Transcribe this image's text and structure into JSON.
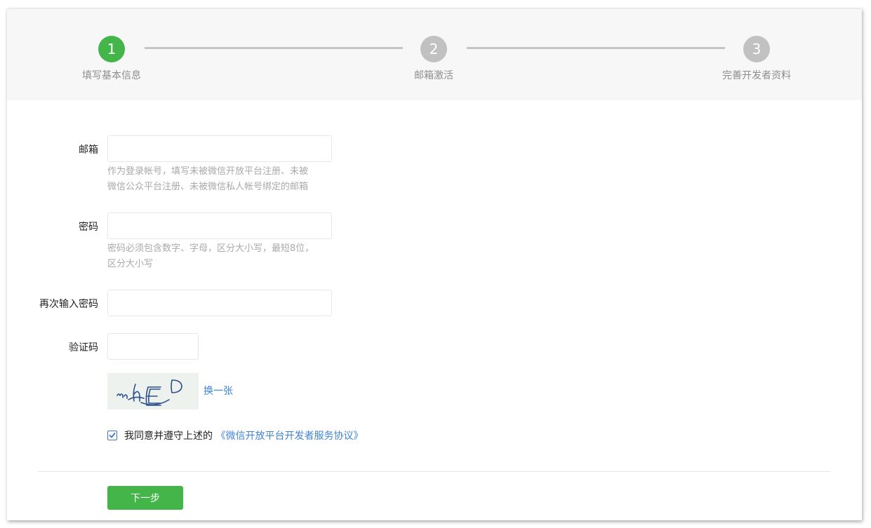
{
  "steps": [
    {
      "number": "1",
      "label": "填写基本信息"
    },
    {
      "number": "2",
      "label": "邮箱激活"
    },
    {
      "number": "3",
      "label": "完善开发者资料"
    }
  ],
  "form": {
    "email": {
      "label": "邮箱",
      "value": "",
      "hint_line1": "作为登录帐号，填写未被微信开放平台注册、未被",
      "hint_line2": "微信公众平台注册、未被微信私人帐号绑定的邮箱"
    },
    "password": {
      "label": "密码",
      "value": "",
      "hint_line1": "密码必须包含数字、字母，区分大小写，最短8位，",
      "hint_line2": "区分大小写"
    },
    "confirm_password": {
      "label": "再次输入密码",
      "value": ""
    },
    "captcha": {
      "label": "验证码",
      "value": "",
      "refresh_label": "换一张"
    }
  },
  "agreement": {
    "checked": true,
    "text": "我同意并遵守上述的",
    "link_text": "《微信开放平台开发者服务协议》"
  },
  "next_button": {
    "label": "下一步"
  },
  "colors": {
    "accent_green": "#44b549",
    "inactive_gray": "#c1c1c1",
    "link_blue": "#3f83d8"
  }
}
